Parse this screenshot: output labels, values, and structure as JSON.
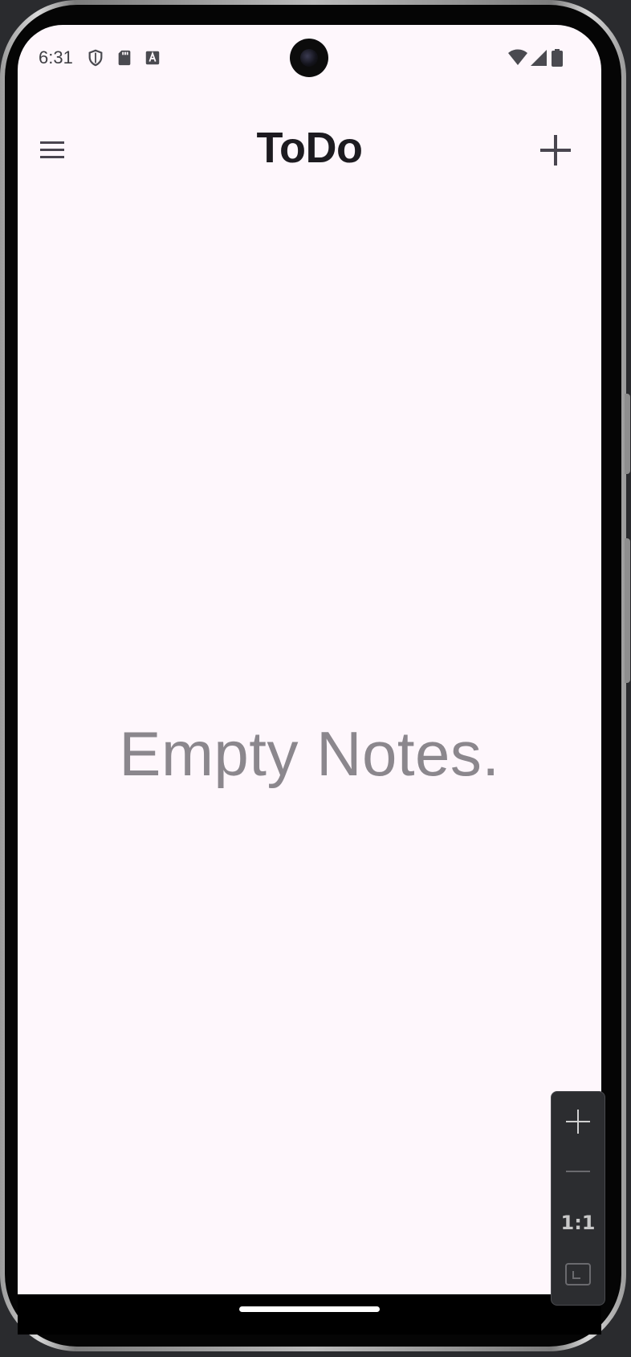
{
  "status_bar": {
    "time": "6:31",
    "left_icons": [
      "shield-icon",
      "sd-card-icon",
      "text-a-icon"
    ],
    "right_icons": [
      "wifi-icon",
      "signal-icon",
      "battery-icon"
    ]
  },
  "app_bar": {
    "title": "ToDo",
    "menu_icon": "hamburger-menu-icon",
    "add_icon": "plus-icon"
  },
  "content": {
    "empty_message": "Empty Notes."
  },
  "emulator_zoom_controls": {
    "zoom_in_icon": "plus-icon",
    "zoom_out_icon": "minus-icon",
    "actual_size_label": "1:1",
    "fit_icon": "fit-screen-icon"
  },
  "colors": {
    "screen_background": "#fef7fc",
    "title_text": "#1d1b20",
    "empty_text": "#8b878d",
    "icon": "#49454f"
  }
}
